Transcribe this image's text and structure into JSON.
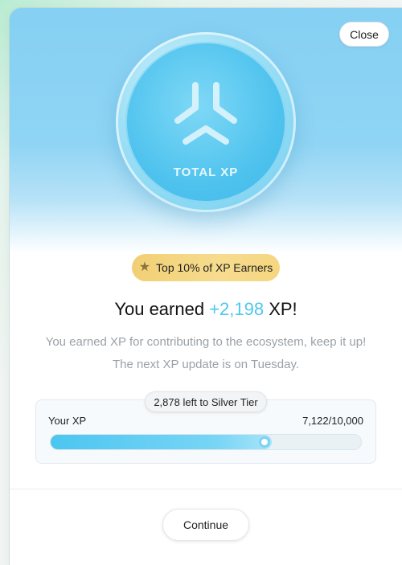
{
  "modal": {
    "close_label": "Close",
    "coin": {
      "title": "TOTAL XP",
      "icon": "xp-logo-icon"
    },
    "badge": {
      "icon": "star-icon",
      "label": "Top 10% of XP Earners"
    },
    "headline": {
      "prefix": "You earned ",
      "amount": "+2,198",
      "suffix": " XP!"
    },
    "description": "You earned XP for contributing to the ecosystem, keep it up! The next XP update is on Tuesday.",
    "progress": {
      "tier_note": "2,878 left to Silver Tier",
      "label": "Your XP",
      "value_text": "7,122/10,000",
      "current": 7122,
      "max": 10000
    },
    "continue_label": "Continue"
  },
  "colors": {
    "accent": "#4ec7ef",
    "badge_gold": "#f1cf74",
    "hero_blue": "#85d0f3"
  }
}
